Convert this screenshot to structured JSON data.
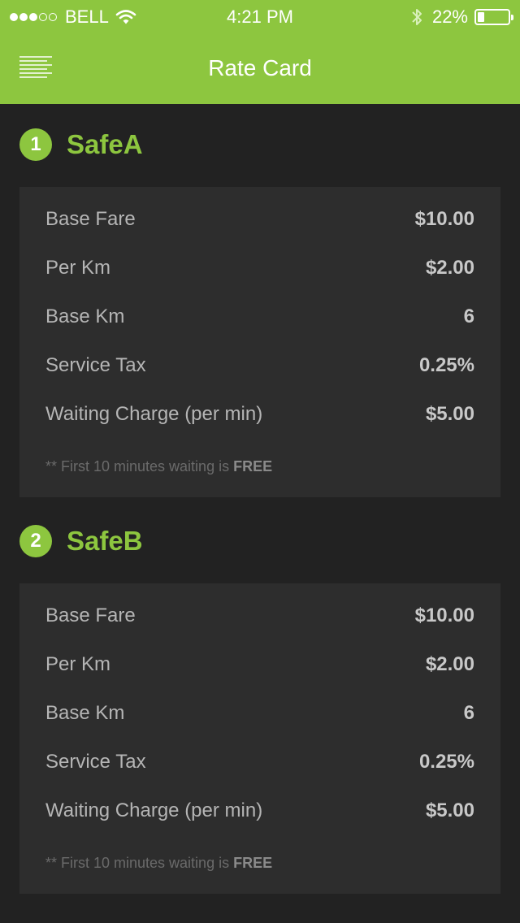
{
  "status_bar": {
    "signal_dots_filled": 3,
    "signal_dots_total": 5,
    "carrier": "BELL",
    "time": "4:21 PM",
    "battery_percent": "22%",
    "battery_level": 0.22,
    "icons": [
      "wifi-icon",
      "bluetooth-icon",
      "battery-icon"
    ]
  },
  "nav": {
    "title": "Rate Card",
    "menu_icon": "menu-icon"
  },
  "colors": {
    "accent": "#8dc63f",
    "background": "#222222",
    "card": "#2d2d2d"
  },
  "sections": [
    {
      "number": "1",
      "name": "SafeA",
      "rows": [
        {
          "label": "Base Fare",
          "value": "$10.00"
        },
        {
          "label": "Per Km",
          "value": "$2.00"
        },
        {
          "label": "Base Km",
          "value": "6"
        },
        {
          "label": "Service Tax",
          "value": "0.25%"
        },
        {
          "label": "Waiting Charge (per min)",
          "value": "$5.00"
        }
      ],
      "note_prefix": "** First 10 minutes waiting is",
      "note_emphasis": "FREE"
    },
    {
      "number": "2",
      "name": "SafeB",
      "rows": [
        {
          "label": "Base Fare",
          "value": "$10.00"
        },
        {
          "label": "Per Km",
          "value": "$2.00"
        },
        {
          "label": "Base Km",
          "value": "6"
        },
        {
          "label": "Service Tax",
          "value": "0.25%"
        },
        {
          "label": "Waiting Charge (per min)",
          "value": "$5.00"
        }
      ],
      "note_prefix": "** First 10 minutes waiting is",
      "note_emphasis": "FREE"
    }
  ]
}
